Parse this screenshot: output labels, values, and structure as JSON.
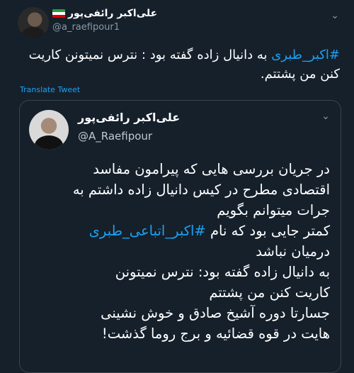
{
  "tweet": {
    "name": "علی‌اکبر رائفی‌پور",
    "handle": "@a_raefipour1",
    "text_hashtag": "#اکبر_طبری",
    "text_rest": " به دانیال زاده گفته بود : نترس نمیتونن کاریت کنن من پشتتم.",
    "translate": "Translate Tweet"
  },
  "quote": {
    "name": "علی‌اکبر رائفی‌پور",
    "handle": "@A_Raefipour",
    "lines": [
      "در جریان بررسی هایی که پیرامون مفاسد",
      "اقتصادی مطرح در کیس دانیال زاده داشتم به",
      "جرات میتوانم بگویم",
      "کمتر جایی بود که نام",
      "#اکبر_اتباعی_طبری",
      "درمیان نباشد",
      "به دانیال زاده گفته بود: نترس نمیتونن",
      "کاریت کنن من پشتتم",
      "جسارتا دوره آشیخ صادق و خوش نشینی",
      "هایت در قوه قضائیه و برج روما گذشت!"
    ]
  },
  "icons": {
    "tweet_menu": "chevron-down-icon",
    "quote_menu": "chevron-down-icon",
    "flag": "iran-flag-icon"
  },
  "colors": {
    "background": "#15202b",
    "link": "#1da1f2",
    "muted": "#8899a6"
  }
}
